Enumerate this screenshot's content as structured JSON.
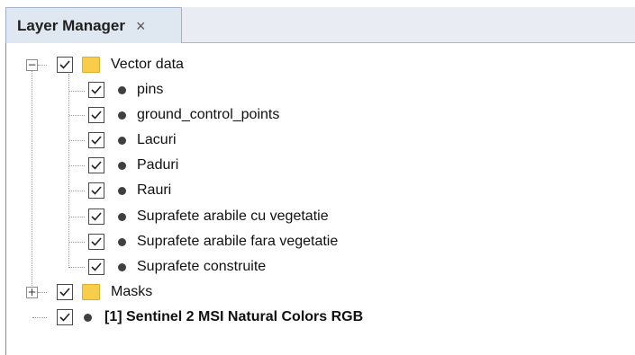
{
  "tab": {
    "title": "Layer Manager",
    "close_glyph": "×"
  },
  "tree": {
    "vector_group": {
      "label": "Vector data",
      "checked": true,
      "expanded": true,
      "expander_glyph": "−",
      "children": [
        {
          "label": "pins",
          "checked": true
        },
        {
          "label": "ground_control_points",
          "checked": true
        },
        {
          "label": "Lacuri",
          "checked": true
        },
        {
          "label": "Paduri",
          "checked": true
        },
        {
          "label": "Rauri",
          "checked": true
        },
        {
          "label": "Suprafete arabile cu vegetatie",
          "checked": true
        },
        {
          "label": "Suprafete arabile fara vegetatie",
          "checked": true
        },
        {
          "label": "Suprafete construite",
          "checked": true
        }
      ]
    },
    "masks_group": {
      "label": "Masks",
      "checked": true,
      "expanded": false,
      "expander_glyph": "+"
    },
    "raster_layer": {
      "label": "[1] Sentinel 2 MSI Natural Colors RGB",
      "checked": true
    }
  },
  "colors": {
    "folder": "#f7cd4a",
    "tab_bg": "#dfe7f1",
    "dot": "#3f3f3f"
  },
  "icons": {
    "folder": "folder-icon",
    "layer": "layer-dot-icon",
    "check": "checkmark-icon"
  }
}
